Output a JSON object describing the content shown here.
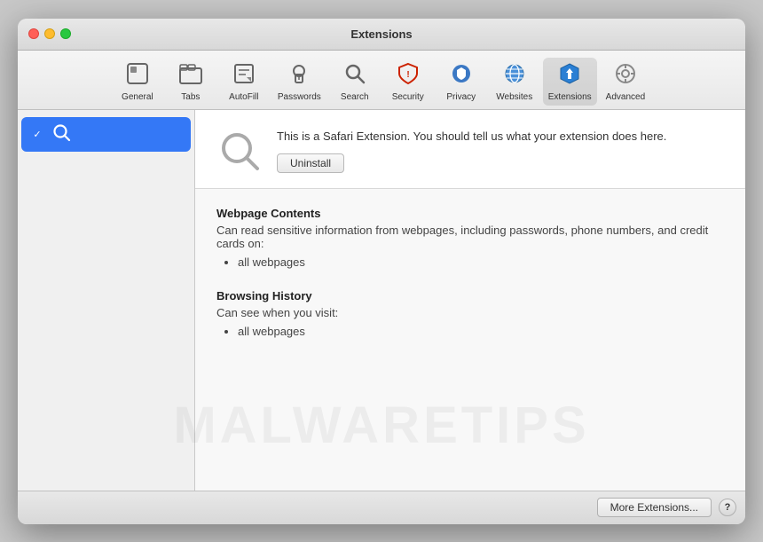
{
  "window": {
    "title": "Extensions",
    "controls": {
      "close_label": "close",
      "minimize_label": "minimize",
      "maximize_label": "maximize"
    }
  },
  "toolbar": {
    "items": [
      {
        "id": "general",
        "label": "General",
        "icon": "⬜"
      },
      {
        "id": "tabs",
        "label": "Tabs",
        "icon": "🗂"
      },
      {
        "id": "autofill",
        "label": "AutoFill",
        "icon": "✏️"
      },
      {
        "id": "passwords",
        "label": "Passwords",
        "icon": "🔑"
      },
      {
        "id": "search",
        "label": "Search",
        "icon": "🔍"
      },
      {
        "id": "security",
        "label": "Security",
        "icon": "🛡"
      },
      {
        "id": "privacy",
        "label": "Privacy",
        "icon": "✋"
      },
      {
        "id": "websites",
        "label": "Websites",
        "icon": "🌐"
      },
      {
        "id": "extensions",
        "label": "Extensions",
        "icon": "🧩"
      },
      {
        "id": "advanced",
        "label": "Advanced",
        "icon": "⚙️"
      }
    ]
  },
  "sidebar": {
    "items": [
      {
        "id": "search-ext",
        "label": "🔍",
        "checked": true
      }
    ]
  },
  "detail": {
    "description": "This is a Safari Extension. You should tell us what your extension does here.",
    "uninstall_label": "Uninstall",
    "permissions": [
      {
        "title": "Webpage Contents",
        "desc": "Can read sensitive information from webpages, including passwords, phone numbers, and credit cards on:",
        "items": [
          "all webpages"
        ]
      },
      {
        "title": "Browsing History",
        "desc": "Can see when you visit:",
        "items": [
          "all webpages"
        ]
      }
    ]
  },
  "bottom_bar": {
    "more_extensions_label": "More Extensions...",
    "help_label": "?"
  },
  "watermark": {
    "text": "MALWARETIPS"
  }
}
